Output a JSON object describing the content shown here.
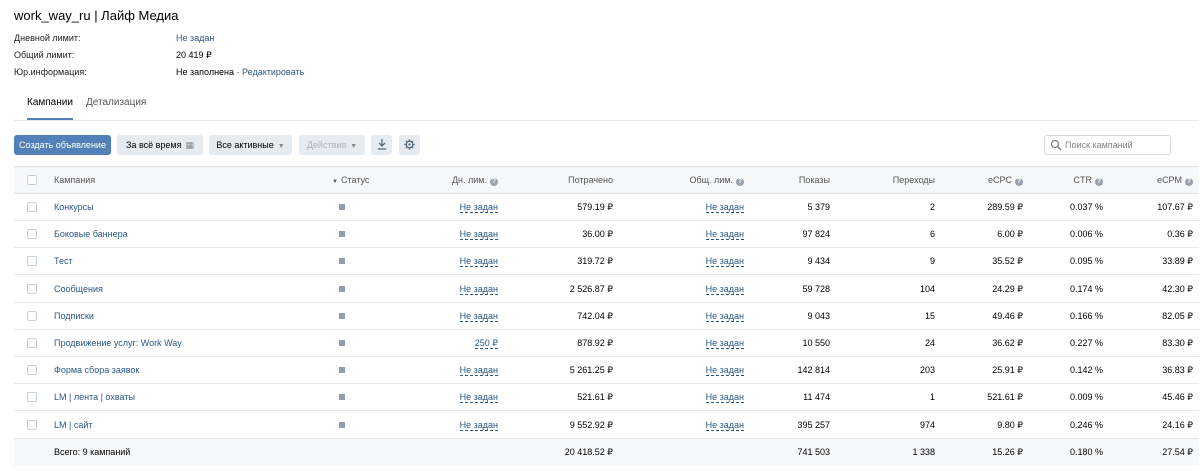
{
  "header": {
    "title": "work_way_ru | Лайф Медиа",
    "daily_limit_label": "Дневной лимит:",
    "daily_limit_value": "Не задан",
    "total_limit_label": "Общий лимит:",
    "total_limit_value": "20 419 ₽",
    "legal_label": "Юр.информация:",
    "legal_value": "Не заполнена",
    "legal_sep": " · ",
    "legal_edit": "Редактировать"
  },
  "tabs": [
    {
      "label": "Кампании",
      "active": true
    },
    {
      "label": "Детализация",
      "active": false
    }
  ],
  "toolbar": {
    "create_label": "Создать объявление",
    "period_label": "За всё время",
    "filter_label": "Все активные",
    "actions_label": "Действия",
    "download_icon": "download-icon",
    "settings_icon": "gear-icon",
    "search_placeholder": "Поиск кампаний"
  },
  "columns": {
    "campaign": "Кампания",
    "status": "Статус",
    "daily_limit": "Дн. лим.",
    "spent": "Потрачено",
    "total_limit": "Общ. лим.",
    "impressions": "Показы",
    "clicks": "Переходы",
    "ecpc": "eCPC",
    "ctr": "CTR",
    "ecpm": "eCPM"
  },
  "rows": [
    {
      "name": "Конкурсы",
      "daily": "Не задан",
      "spent": "579.19 ₽",
      "total": "Не задан",
      "shows": "5 379",
      "clicks": "2",
      "ecpc": "289.59 ₽",
      "ctr": "0.037 %",
      "ecpm": "107.67 ₽"
    },
    {
      "name": "Боковые баннера",
      "daily": "Не задан",
      "spent": "36.00 ₽",
      "total": "Не задан",
      "shows": "97 824",
      "clicks": "6",
      "ecpc": "6.00 ₽",
      "ctr": "0.006 %",
      "ecpm": "0.36 ₽"
    },
    {
      "name": "Тест",
      "daily": "Не задан",
      "spent": "319.72 ₽",
      "total": "Не задан",
      "shows": "9 434",
      "clicks": "9",
      "ecpc": "35.52 ₽",
      "ctr": "0.095 %",
      "ecpm": "33.89 ₽"
    },
    {
      "name": "Сообщения",
      "daily": "Не задан",
      "spent": "2 526.87 ₽",
      "total": "Не задан",
      "shows": "59 728",
      "clicks": "104",
      "ecpc": "24.29 ₽",
      "ctr": "0.174 %",
      "ecpm": "42.30 ₽"
    },
    {
      "name": "Подписки",
      "daily": "Не задан",
      "spent": "742.04 ₽",
      "total": "Не задан",
      "shows": "9 043",
      "clicks": "15",
      "ecpc": "49.46 ₽",
      "ctr": "0.166 %",
      "ecpm": "82.05 ₽"
    },
    {
      "name": "Продвижение услуг: Work Way",
      "daily": "250 ₽",
      "spent": "878.92 ₽",
      "total": "Не задан",
      "shows": "10 550",
      "clicks": "24",
      "ecpc": "36.62 ₽",
      "ctr": "0.227 %",
      "ecpm": "83.30 ₽"
    },
    {
      "name": "Форма сбора заявок",
      "daily": "Не задан",
      "spent": "5 261.25 ₽",
      "total": "Не задан",
      "shows": "142 814",
      "clicks": "203",
      "ecpc": "25.91 ₽",
      "ctr": "0.142 %",
      "ecpm": "36.83 ₽"
    },
    {
      "name": "LM | лента | охваты",
      "daily": "Не задан",
      "spent": "521.61 ₽",
      "total": "Не задан",
      "shows": "11 474",
      "clicks": "1",
      "ecpc": "521.61 ₽",
      "ctr": "0.009 %",
      "ecpm": "45.46 ₽"
    },
    {
      "name": "LM | сайт",
      "daily": "Не задан",
      "spent": "9 552.92 ₽",
      "total": "Не задан",
      "shows": "395 257",
      "clicks": "974",
      "ecpc": "9.80 ₽",
      "ctr": "0.246 %",
      "ecpm": "24.16 ₽"
    }
  ],
  "total": {
    "label": "Всего: 9 кампаний",
    "spent": "20 418.52 ₽",
    "shows": "741 503",
    "clicks": "1 338",
    "ecpc": "15.26 ₽",
    "ctr": "0.180 %",
    "ecpm": "27.54 ₽"
  },
  "colors": {
    "accent": "#5181b8",
    "link": "#2a5885",
    "status_grey": "#939ea9"
  }
}
